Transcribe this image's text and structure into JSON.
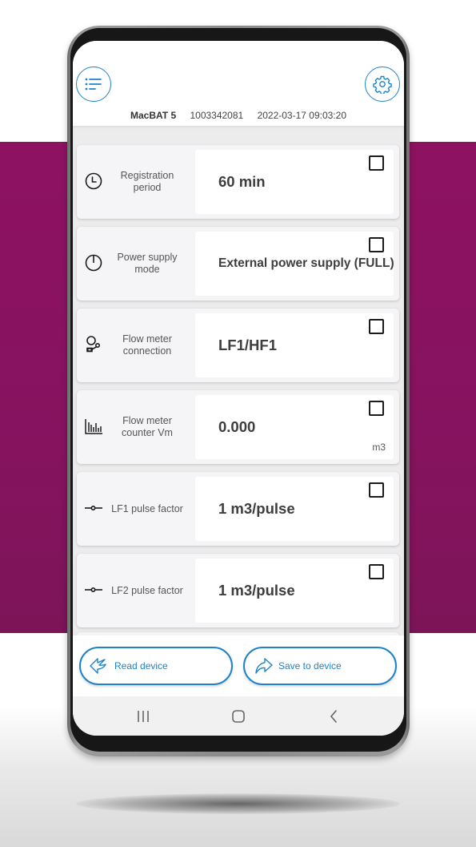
{
  "header": {
    "menu_icon": "list-icon",
    "settings_icon": "gear-icon",
    "device_model": "MacBAT 5",
    "serial_number": "1003342081",
    "timestamp": "2022-03-17 09:03:20"
  },
  "parameters": [
    {
      "icon": "clock-icon",
      "label": "Registration period",
      "value": "60 min",
      "unit": "",
      "checked": false
    },
    {
      "icon": "power-icon",
      "label": "Power supply mode",
      "value": "External power supply (FULL)",
      "unit": "",
      "checked": false
    },
    {
      "icon": "flow-meter-connection-icon",
      "label": "Flow meter connection",
      "value": "LF1/HF1",
      "unit": "",
      "checked": false
    },
    {
      "icon": "bar-chart-icon",
      "label": "Flow meter counter Vm",
      "value": "0.000",
      "unit": "m3",
      "checked": false
    },
    {
      "icon": "pulse-icon",
      "label": "LF1 pulse factor",
      "value": "1 m3/pulse",
      "unit": "",
      "checked": false
    },
    {
      "icon": "pulse-icon",
      "label": "LF2 pulse factor",
      "value": "1 m3/pulse",
      "unit": "",
      "checked": false
    }
  ],
  "actions": {
    "read_label": "Read device",
    "save_label": "Save to device"
  },
  "navbar": {
    "recent_icon": "recent-apps-icon",
    "home_icon": "home-icon",
    "back_icon": "back-icon"
  },
  "colors": {
    "accent": "#1e83c8",
    "background_band": "#8a1360",
    "value_text": "#3d3d3d"
  }
}
